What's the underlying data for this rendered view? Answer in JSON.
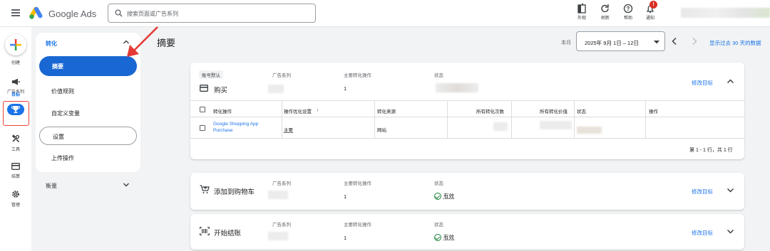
{
  "app": {
    "name": "Google Ads"
  },
  "search": {
    "placeholder": "搜索页面或广告系列"
  },
  "toolbar": {
    "appearance_label": "外观",
    "refresh_label": "刷新",
    "help_label": "帮助",
    "notifications_label": "通知",
    "notifications_badge": "!"
  },
  "rail": {
    "create_label": "创建",
    "campaigns_label": "广告系列",
    "goals_label": "目标",
    "tools_label": "工具",
    "billing_label": "结算",
    "admin_label": "管理"
  },
  "subnav": {
    "section_title": "转化",
    "items": [
      {
        "label": "摘要"
      },
      {
        "label": "价值规则"
      },
      {
        "label": "自定义变量"
      },
      {
        "label": "设置"
      },
      {
        "label": "上传操作"
      }
    ],
    "measure_label": "衡量"
  },
  "main": {
    "title": "摘要",
    "period_label": "本月",
    "date_range": "2025年 9月 1日 – 12日",
    "show_30_days": "显示过去 30 天的数据"
  },
  "cards": [
    {
      "tag": "账号默认",
      "name": "购买",
      "campaign_label": "广告系列",
      "primary_actions_label": "主要转化操作",
      "primary_actions_value": "1",
      "status_label": "状态",
      "status_value": "",
      "edit_label": "修改目标",
      "table": {
        "headers": [
          "转化操作",
          "操作优化设置",
          "转化来源",
          "所有转化次数",
          "所有转化价值",
          "状态",
          "操作"
        ],
        "sort_indicator": "↓",
        "rows": [
          {
            "action": "Google Shopping App Purchase",
            "optimization": "主要",
            "source": "网站"
          }
        ],
        "pager": "第 1 - 1 行，共 1 行"
      }
    },
    {
      "name": "添加到购物车",
      "campaign_label": "广告系列",
      "primary_actions_label": "主要转化操作",
      "primary_actions_value": "1",
      "status_label": "状态",
      "status_value": "有效",
      "edit_label": "修改目标"
    },
    {
      "name": "开始结账",
      "campaign_label": "广告系列",
      "primary_actions_label": "主要转化操作",
      "primary_actions_value": "1",
      "status_label": "状态",
      "status_value": "有效",
      "edit_label": "修改目标"
    }
  ],
  "colors": {
    "accent": "#1a73e8",
    "active_nav": "#1967d2",
    "highlight": "#ea4335",
    "ok": "#188038"
  }
}
